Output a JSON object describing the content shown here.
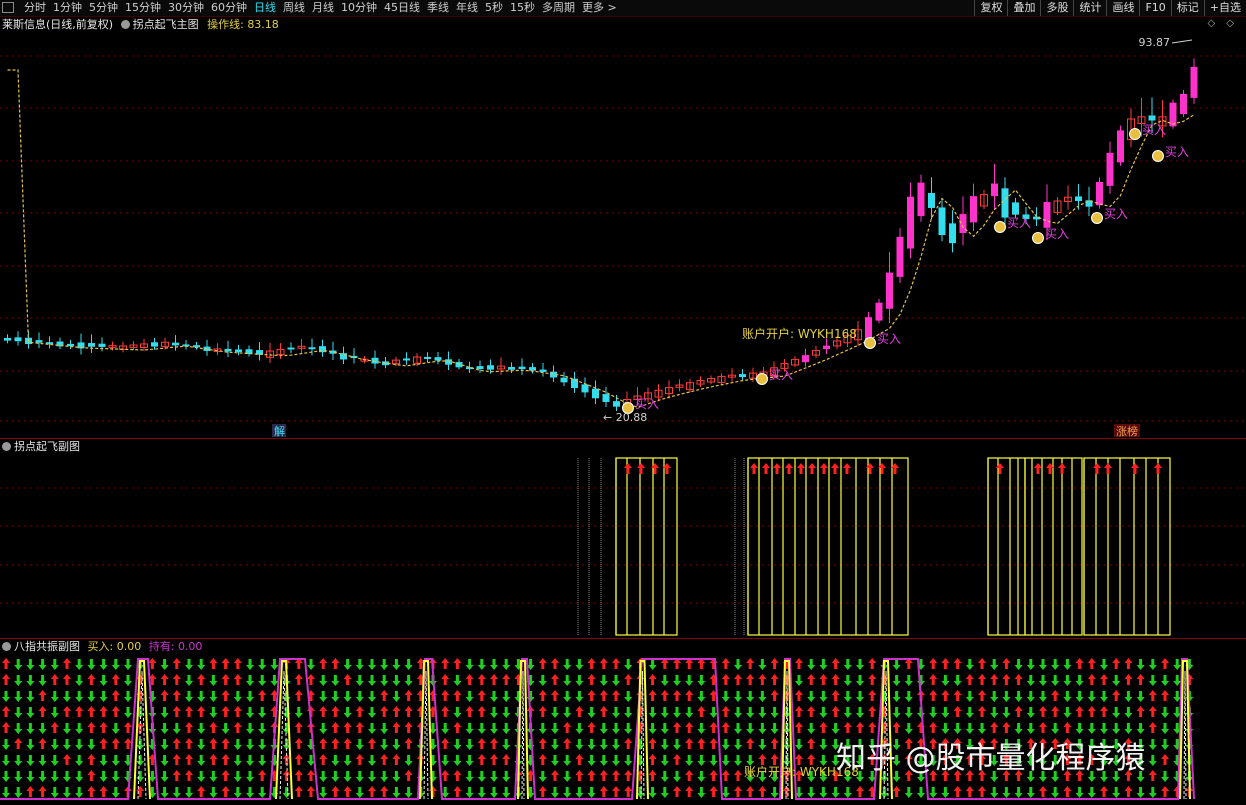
{
  "toolbar": {
    "periods": [
      "分时",
      "1分钟",
      "5分钟",
      "15分钟",
      "30分钟",
      "60分钟",
      "日线",
      "周线",
      "月线",
      "10分钟",
      "45日线",
      "季线",
      "年线",
      "5秒",
      "15秒",
      "多周期",
      "更多 >"
    ],
    "active_period": "日线",
    "right_buttons": [
      "复权",
      "叠加",
      "多股",
      "统计",
      "画线",
      "F10",
      "标记",
      "+自选"
    ]
  },
  "main": {
    "stock_title": "莱斯信息(日线,前复权)",
    "indicator_name": "拐点起飞主图",
    "op_label": "操作线:",
    "op_value": "83.18",
    "high_label": "93.87",
    "low_label": "← 20.88",
    "buy_label": "买入",
    "account_text": "账户开户: WYKH168",
    "badge_left": "解",
    "badge_right": "涨榜",
    "window_controls": "◇ ◇"
  },
  "sub1": {
    "title": "拐点起飞副图"
  },
  "sub2": {
    "title": "八指共振副图",
    "buy_label": "买入:",
    "buy_value": "0.00",
    "hold_label": "持有:",
    "hold_value": "0.00",
    "account_text": "账户开户: WYKH168"
  },
  "watermark": "知乎 @股市量化程序猿",
  "colors": {
    "up": "#ff3b3b",
    "down": "#33ddee",
    "limit_up": "#ff33cc",
    "ma": "#e5c04a",
    "signal": "#ffff40",
    "arrow_up": "#ff2020",
    "arrow_down": "#20d020",
    "magenta": "#cc33cc",
    "divider": "#8a0000"
  }
}
